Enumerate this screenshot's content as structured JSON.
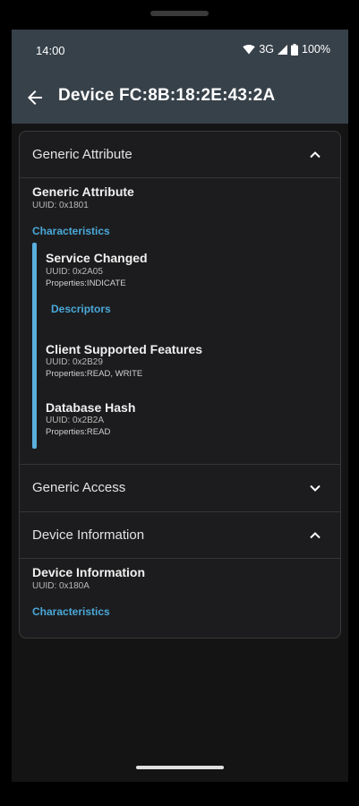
{
  "status_bar": {
    "time": "14:00",
    "network": "3G",
    "battery": "100%"
  },
  "app_bar": {
    "title": "Device FC:8B:18:2E:43:2A",
    "back_icon": "arrow-back-icon"
  },
  "sections": [
    {
      "header": "Generic Attribute",
      "expanded": true,
      "service_name": "Generic Attribute",
      "service_uuid": "UUID: 0x1801",
      "characteristics_label": "Characteristics",
      "characteristics": [
        {
          "name": "Service Changed",
          "uuid": "UUID: 0x2A05",
          "properties": "Properties:INDICATE",
          "descriptors_label": "Descriptors"
        },
        {
          "name": "Client Supported Features",
          "uuid": "UUID: 0x2B29",
          "properties": "Properties:READ,  WRITE"
        },
        {
          "name": "Database Hash",
          "uuid": "UUID: 0x2B2A",
          "properties": "Properties:READ"
        }
      ]
    },
    {
      "header": "Generic Access",
      "expanded": false
    },
    {
      "header": "Device Information",
      "expanded": true,
      "service_name": "Device Information",
      "service_uuid": "UUID: 0x180A",
      "characteristics_label": "Characteristics"
    }
  ],
  "colors": {
    "app_bar": "#37414a",
    "accent": "#4aa8d8",
    "card": "#1c1c1e"
  }
}
